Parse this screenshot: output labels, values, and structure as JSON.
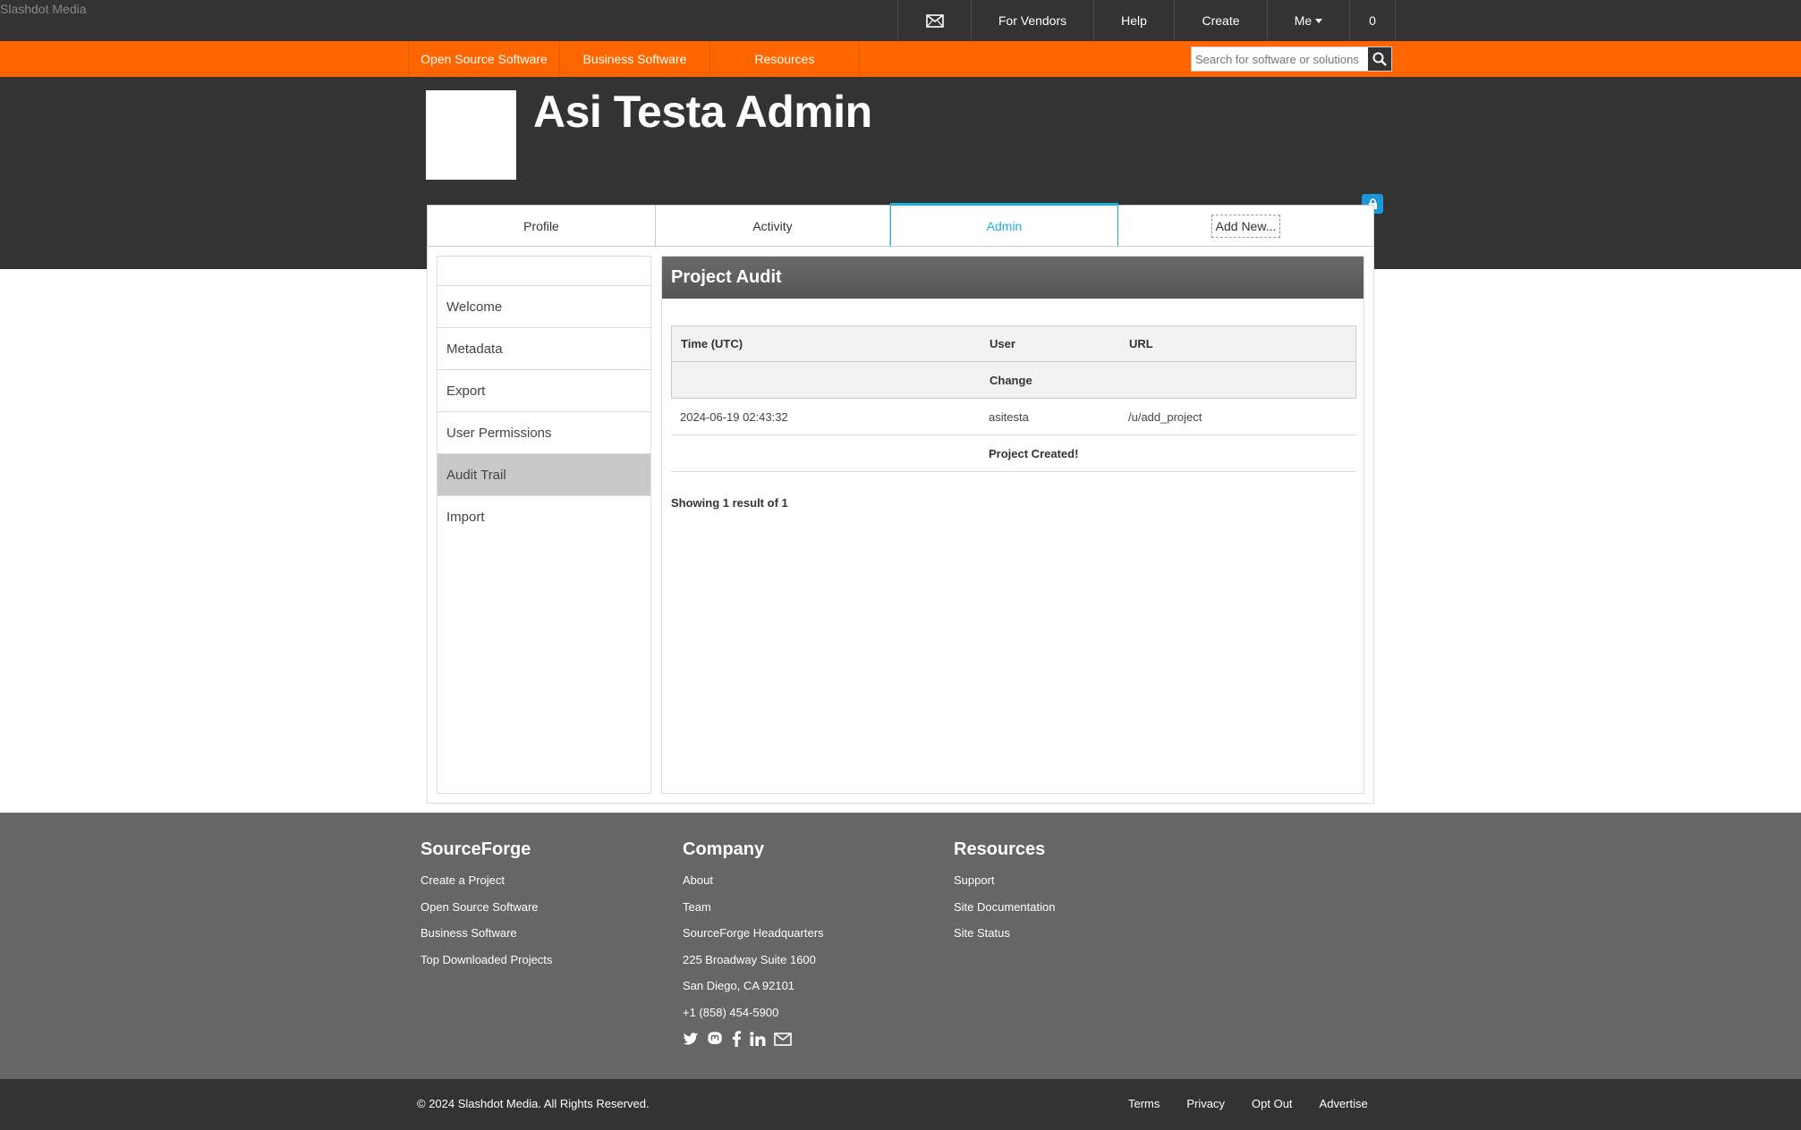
{
  "brand": "Slashdot Media",
  "topnav": {
    "vendors": "For Vendors",
    "help": "Help",
    "create": "Create",
    "me": "Me",
    "count": "0"
  },
  "orangenav": {
    "oss": "Open Source Software",
    "business": "Business Software",
    "resources": "Resources"
  },
  "search": {
    "placeholder": "Search for software or solutions"
  },
  "profile": {
    "title": "Asi Testa Admin"
  },
  "tabs": {
    "profile": "Profile",
    "activity": "Activity",
    "admin": "Admin",
    "add_new": "Add New..."
  },
  "sidebar": {
    "items": [
      "Welcome",
      "Metadata",
      "Export",
      "User Permissions",
      "Audit Trail",
      "Import"
    ],
    "active": "Audit Trail"
  },
  "audit": {
    "title": "Project Audit",
    "headers": {
      "time": "Time (UTC)",
      "user": "User",
      "url": "URL",
      "change": "Change"
    },
    "rows": [
      {
        "time": "2024-06-19 02:43:32",
        "user": "asitesta",
        "url": "/u/add_project",
        "change": "Project Created!"
      }
    ],
    "showing": "Showing 1 result of 1"
  },
  "footer": {
    "col1": {
      "title": "SourceForge",
      "links": [
        "Create a Project",
        "Open Source Software",
        "Business Software",
        "Top Downloaded Projects"
      ]
    },
    "col2": {
      "title": "Company",
      "links": [
        "About",
        "Team",
        "SourceForge Headquarters",
        "225 Broadway Suite 1600",
        "San Diego, CA 92101",
        "+1 (858) 454-5900"
      ]
    },
    "col3": {
      "title": "Resources",
      "links": [
        "Support",
        "Site Documentation",
        "Site Status"
      ]
    },
    "socials": [
      "twitter-icon",
      "mastodon-icon",
      "facebook-icon",
      "linkedin-icon",
      "email-icon"
    ]
  },
  "bottom": {
    "copyright": "© 2024 Slashdot Media. All Rights Reserved.",
    "links": [
      "Terms",
      "Privacy",
      "Opt Out",
      "Advertise"
    ]
  },
  "colors": {
    "orange": "#ff6600",
    "dark": "#333333",
    "accent": "#1ab0e0",
    "footer": "#666666"
  }
}
